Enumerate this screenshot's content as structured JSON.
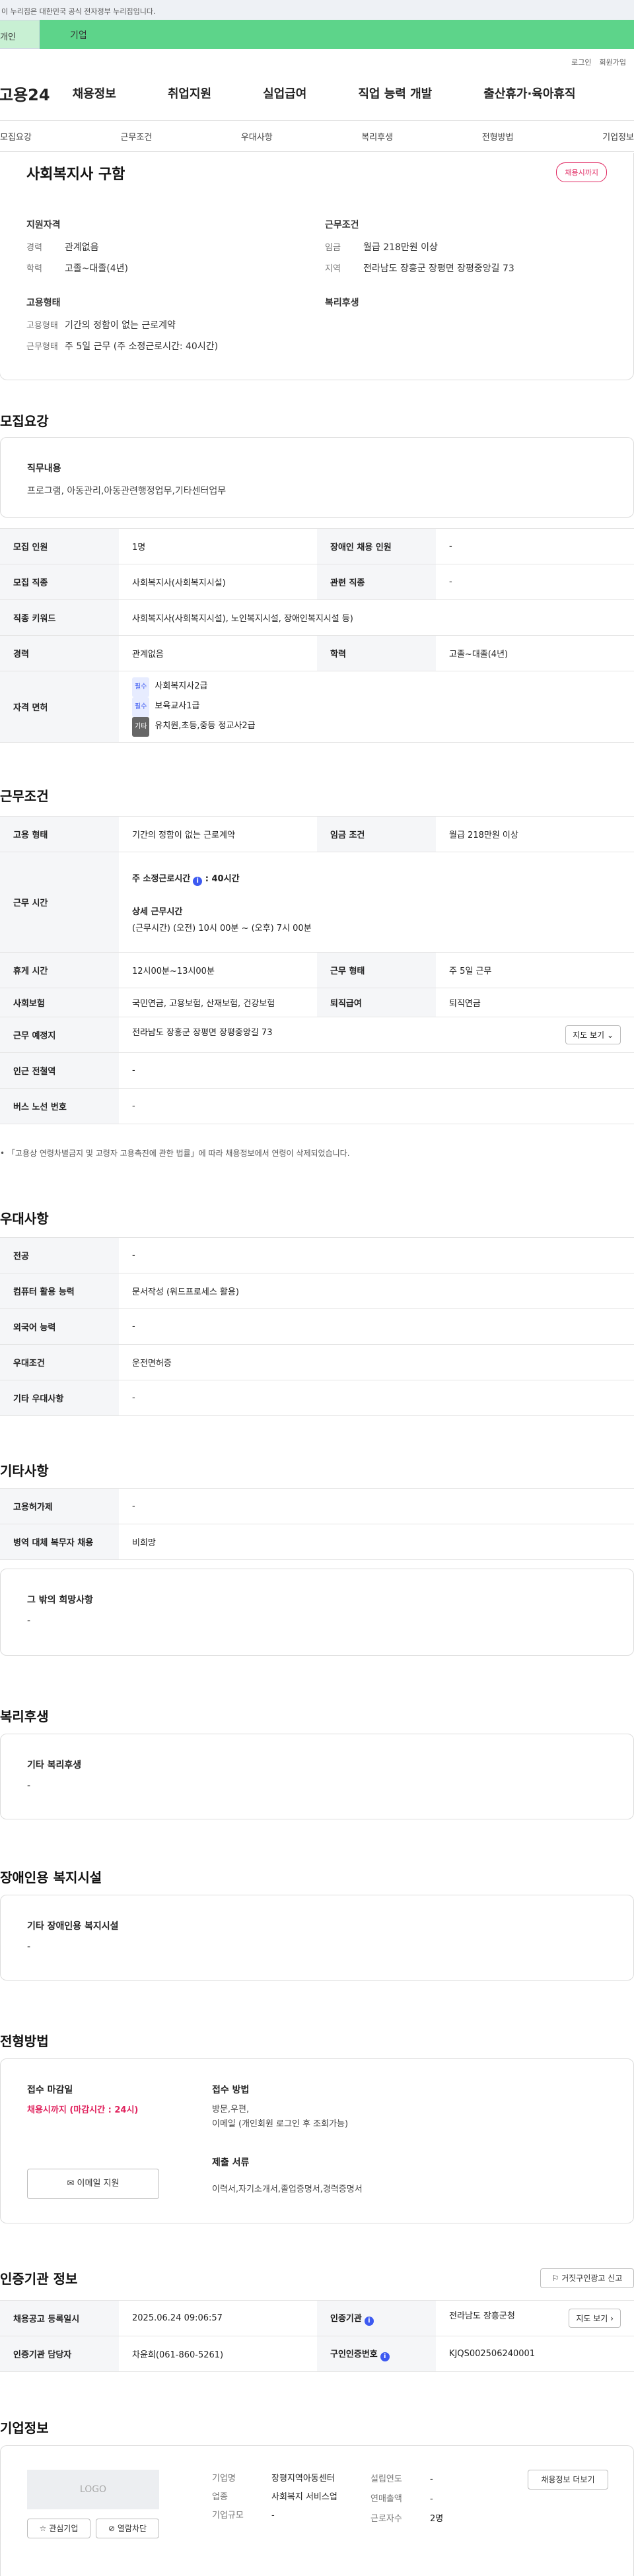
{
  "gov_banner": "이 누리집은 대한민국 공식 전자정부 누리집입니다.",
  "top_tabs": [
    "개인",
    "기업"
  ],
  "util_links": [
    "로그인",
    "회원가입"
  ],
  "logo": "고용24",
  "gnb": [
    "채용정보",
    "취업지원",
    "실업급여",
    "직업 능력 개발",
    "출산휴가·육아휴직"
  ],
  "snb": [
    "모집요강",
    "근무조건",
    "우대사항",
    "복리후생",
    "전형방법",
    "기업정보"
  ],
  "job": {
    "title": "사회복지사 구함",
    "dday": "채용시까지",
    "sec1": "지원자격",
    "exp_k": "경력",
    "exp_v": "관계없음",
    "edu_k": "학력",
    "edu_v": "고졸~대졸(4년)",
    "sec2": "근무조건",
    "pay_k": "임금",
    "pay_v": "월급 218만원 이상",
    "area_k": "지역",
    "area_v": "전라남도 장흥군 장평면 장평중앙길 73",
    "sec3": "고용형태",
    "emp_k": "고용형태",
    "emp_v": "기간의 정함이 없는 근로계약",
    "week_k": "근무형태",
    "week_v": "주 5일 근무 (주 소정근로시간: 40시간)",
    "sec4": "복리후생"
  },
  "recruit": {
    "title": "모집요강",
    "duty_label": "직무내용",
    "duty_value": "프로그램, 아동관리,아동관련행정업무,기타센터업무",
    "rows": {
      "count_h": "모집 인원",
      "count_v": "1명",
      "dis_h": "장애인 채용 인원",
      "dis_v": "-",
      "job_h": "모집 직종",
      "job_v": "사회복지사(사회복지시설)",
      "rel_h": "관련 직종",
      "rel_v": "-",
      "kw_h": "직종 키워드",
      "kw_v": "사회복지사(사회복지시설), 노인복지시설, 장애인복지시설 등)",
      "exp_h": "경력",
      "exp_v": "관계없음",
      "edu_h": "학력",
      "edu_v": "고졸~대졸(4년)",
      "lic_h": "자격 면허",
      "lic1_b": "필수",
      "lic1": "사회복지사2급",
      "lic2_b": "필수",
      "lic2": "보육교사1급",
      "lic3_b": "기타",
      "lic3": "유치원,초등,중등 정교사2급"
    }
  },
  "cond": {
    "title": "근무조건",
    "emp_h": "고용 형태",
    "emp_v": "기간의 정함이 없는 근로계약",
    "pay_h": "임금 조건",
    "pay_v": "월급 218만원 이상",
    "time_h": "근무 시간",
    "hours_label": "주 소정근로시간",
    "hours_v": "40시간",
    "detail_label": "상세 근무시간",
    "detail_v": "(근무시간) (오전) 10시 00분 ~ (오후) 7시 00분",
    "rest_h": "휴게 시간",
    "rest_v": "12시00분~13시00분",
    "form_h": "근무 형태",
    "form_v": "주 5일 근무",
    "ins_h": "사회보험",
    "ins_v": "국민연금, 고용보험, 산재보험, 건강보험",
    "ret_h": "퇴직급여",
    "ret_v": "퇴직연금",
    "place_h": "근무 예정지",
    "place_v": "전라남도 장흥군 장평면 장평중앙길 73",
    "map_btn": "지도 보기",
    "subway_h": "인근 전철역",
    "subway_v": "-",
    "bus_h": "버스 노선 번호",
    "bus_v": "-",
    "note": "「고용상 연령차별금지 및 고령자 고용촉진에 관한 법률」에 따라 채용정보에서 연령이 삭제되었습니다."
  },
  "pref": {
    "title": "우대사항",
    "major_h": "전공",
    "major_v": "-",
    "pc_h": "컴퓨터 활용 능력",
    "pc_v": "문서작성 (워드프로세스 활용)",
    "lang_h": "외국어 능력",
    "lang_v": "-",
    "cond_h": "우대조건",
    "cond_v": "운전면허증",
    "etc_h": "기타 우대사항",
    "etc_v": "-"
  },
  "etc": {
    "title": "기타사항",
    "ins_h": "고용허가제",
    "ins_v": "-",
    "mil_h": "병역 대체 복무자 채용",
    "mil_v": "비희망",
    "other_label": "그 밖의 희망사항",
    "other_v": "-"
  },
  "welfare": {
    "title": "복리후생",
    "label": "기타 복리후생",
    "value": "-"
  },
  "facility": {
    "title": "장애인용 복지시설",
    "label": "기타 장애인용 복지시설",
    "value": "-"
  },
  "process": {
    "title": "전형방법",
    "deadline_label": "접수 마감일",
    "deadline_v": "채용시까지 (마감시간 : 24시)",
    "email_btn": "이메일 지원",
    "method_label": "접수 방법",
    "method_v1": "방문,우편,",
    "method_v2": "이메일 (개인회원 로그인 후 조회가능)",
    "docs_label": "제출 서류",
    "docs_v": "이력서,자기소개서,졸업증명서,경력증명서"
  },
  "cert": {
    "title": "인증기관 정보",
    "report_btn": "거짓구인광고 신고",
    "reg_h": "채용공고 등록일시",
    "reg_v": "2025.06.24 09:06:57",
    "org_h": "인증기관",
    "org_v": "전라남도 장흥군청",
    "more_btn": "지도 보기",
    "mgr_h": "인증기관 담당자",
    "mgr_v": "차윤희(061-860-5261)",
    "num_h": "구인인증번호",
    "num_v": "KJQS002506240001"
  },
  "company": {
    "title": "기업정보",
    "logo": "LOGO",
    "fav_btn": "관심기업",
    "block_btn": "열람차단",
    "name_k": "기업명",
    "name_v": "장평지역아동센터",
    "ind_k": "업종",
    "ind_v": "사회복지 서비스업",
    "size_k": "기업규모",
    "size_v": "-",
    "year_k": "설립연도",
    "year_v": "-",
    "sales_k": "연매출액",
    "sales_v": "-",
    "emp_k": "근로자수",
    "emp_v": "2명",
    "jobs_btn": "채용정보 더보기"
  }
}
